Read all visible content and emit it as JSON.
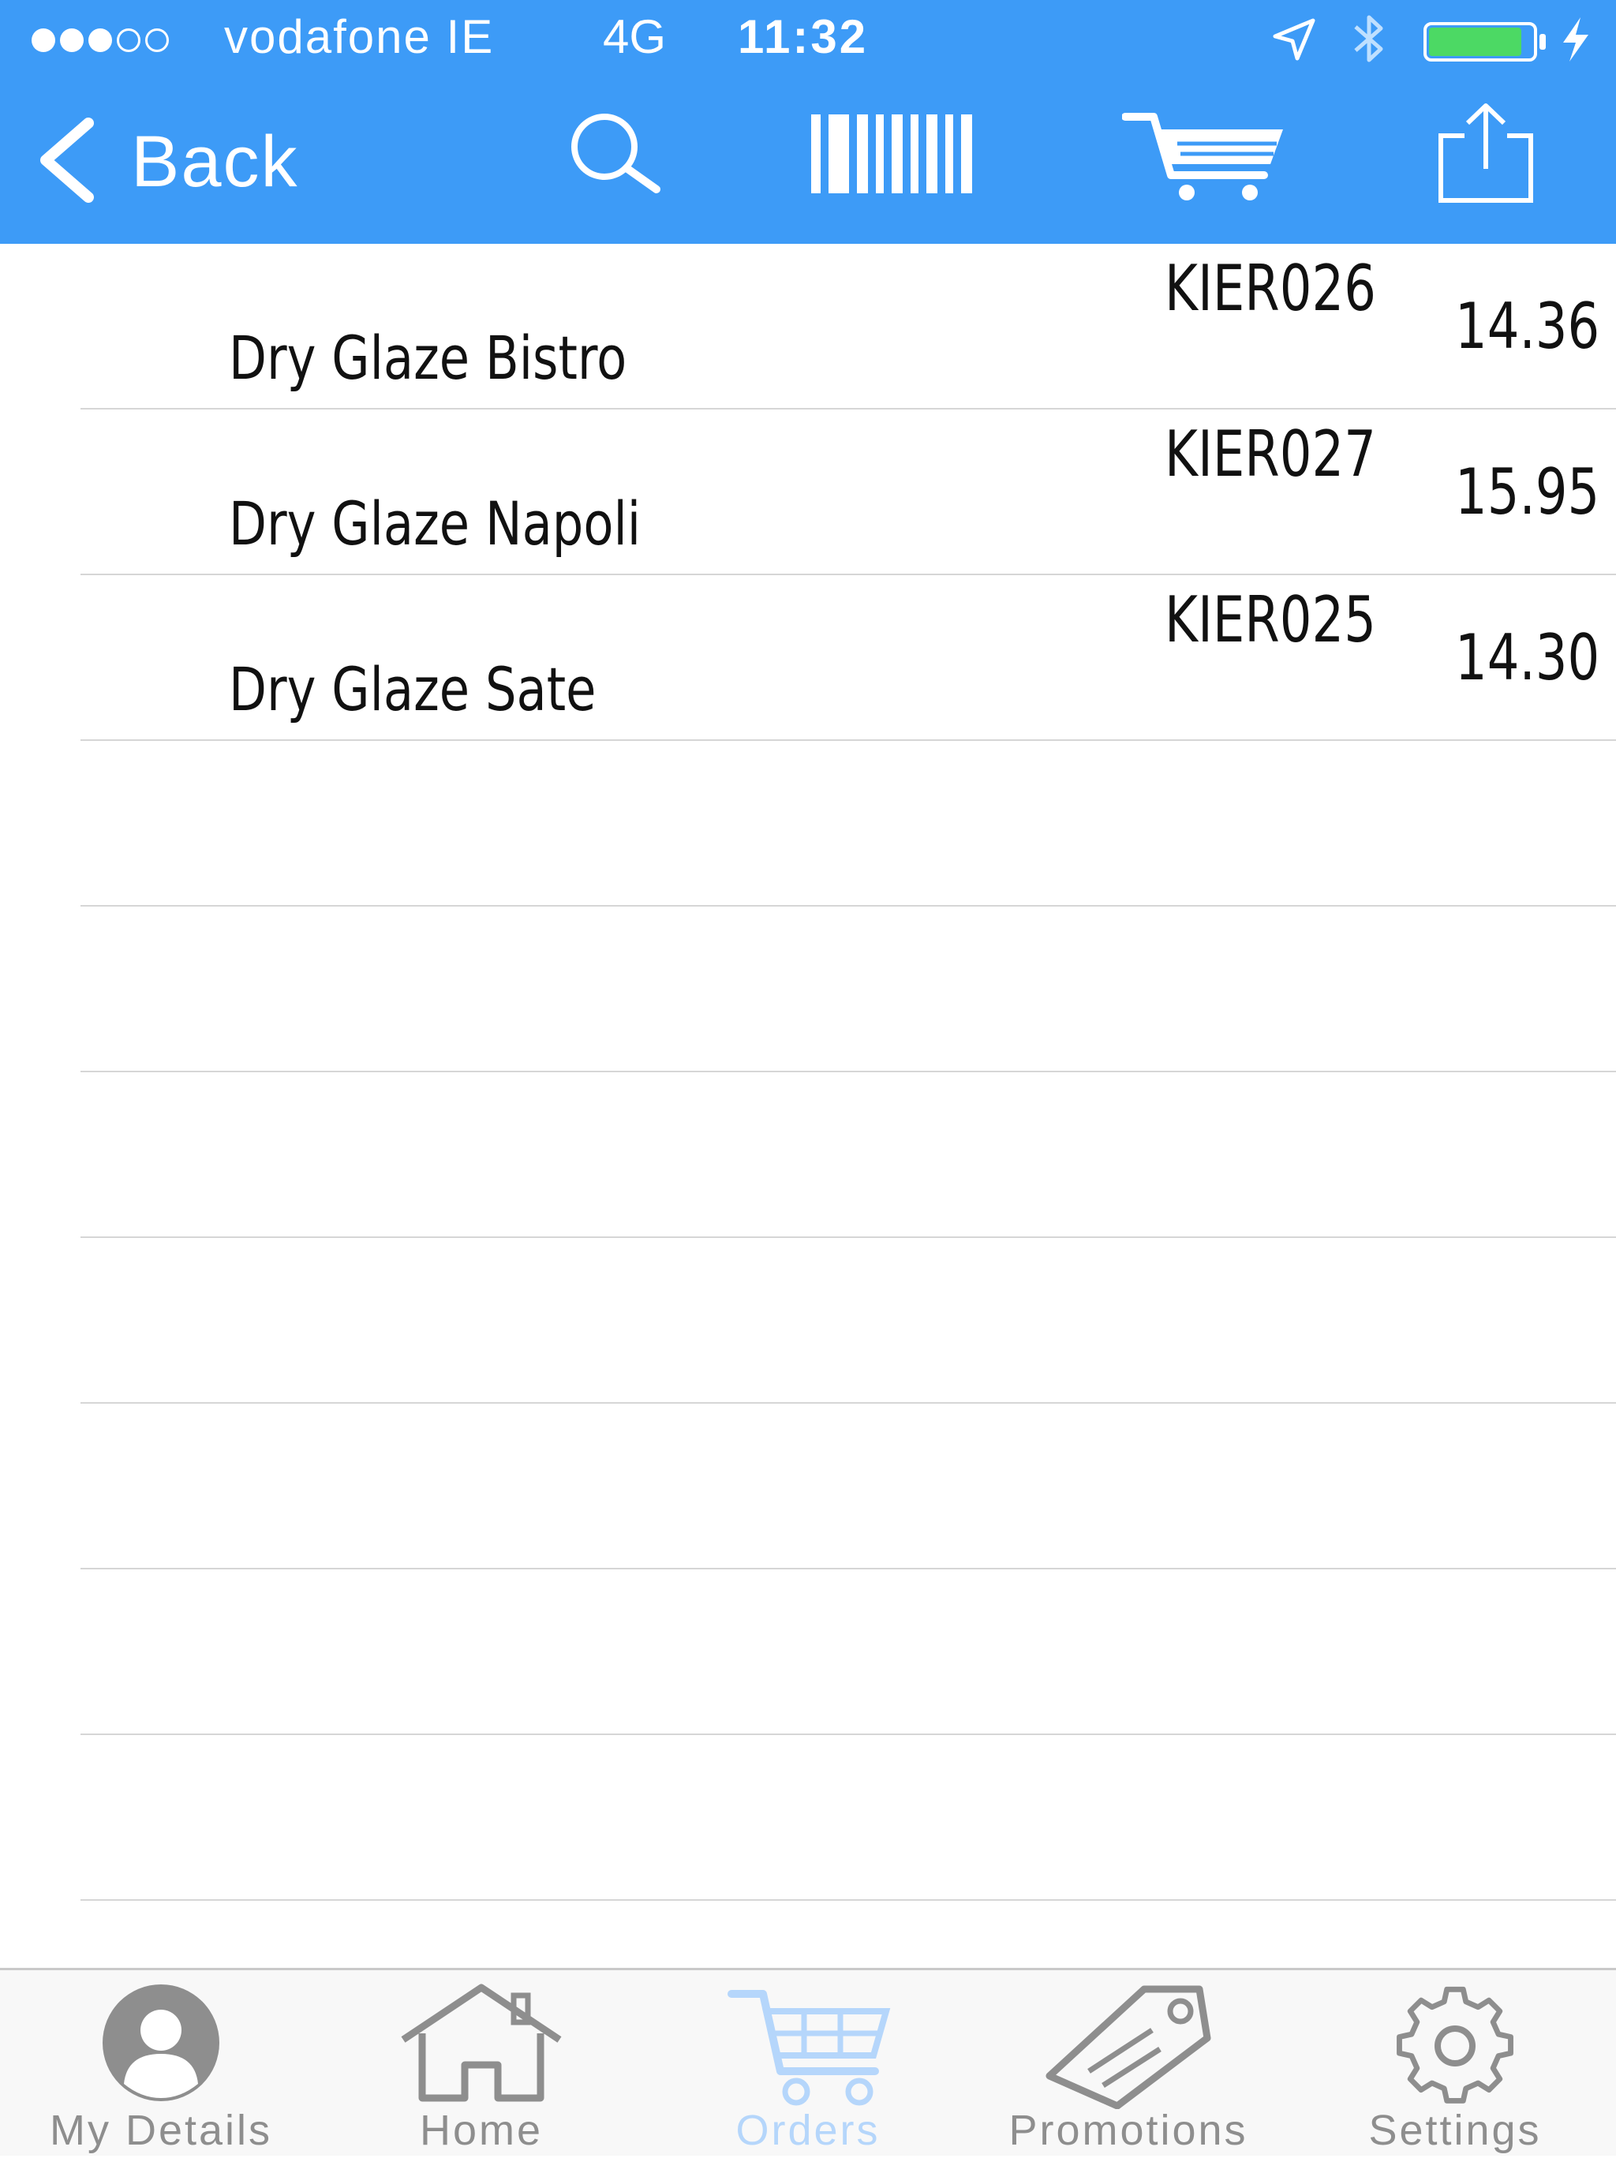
{
  "status_bar": {
    "signal_dots": [
      true,
      true,
      true,
      false,
      false
    ],
    "carrier": "vodafone IE",
    "network": "4G",
    "time": "11:32",
    "battery_level": 0.9,
    "icons": [
      "location-arrow-icon",
      "bluetooth-icon",
      "battery-icon",
      "charging-bolt-icon"
    ]
  },
  "navbar": {
    "back_label": "Back",
    "actions": [
      "search-icon",
      "barcode-icon",
      "cart-icon",
      "share-icon"
    ]
  },
  "products": [
    {
      "name": "Dry Glaze Bistro",
      "code": "KIER026",
      "price": "14.36"
    },
    {
      "name": "Dry Glaze Napoli",
      "code": "KIER027",
      "price": "15.95"
    },
    {
      "name": "Dry Glaze Sate",
      "code": "KIER025",
      "price": "14.30"
    }
  ],
  "tabbar": {
    "tabs": [
      {
        "label": "My Details",
        "icon": "person-icon",
        "active": false
      },
      {
        "label": "Home",
        "icon": "house-icon",
        "active": false
      },
      {
        "label": "Orders",
        "icon": "cart-icon",
        "active": true
      },
      {
        "label": "Promotions",
        "icon": "tag-icon",
        "active": false
      },
      {
        "label": "Settings",
        "icon": "gear-icon",
        "active": false
      }
    ]
  },
  "colors": {
    "navbar": "#3d9bf7",
    "battery": "#4cd964",
    "active_tab": "#b5d6fb",
    "inactive_tab": "#8e8e8e"
  }
}
